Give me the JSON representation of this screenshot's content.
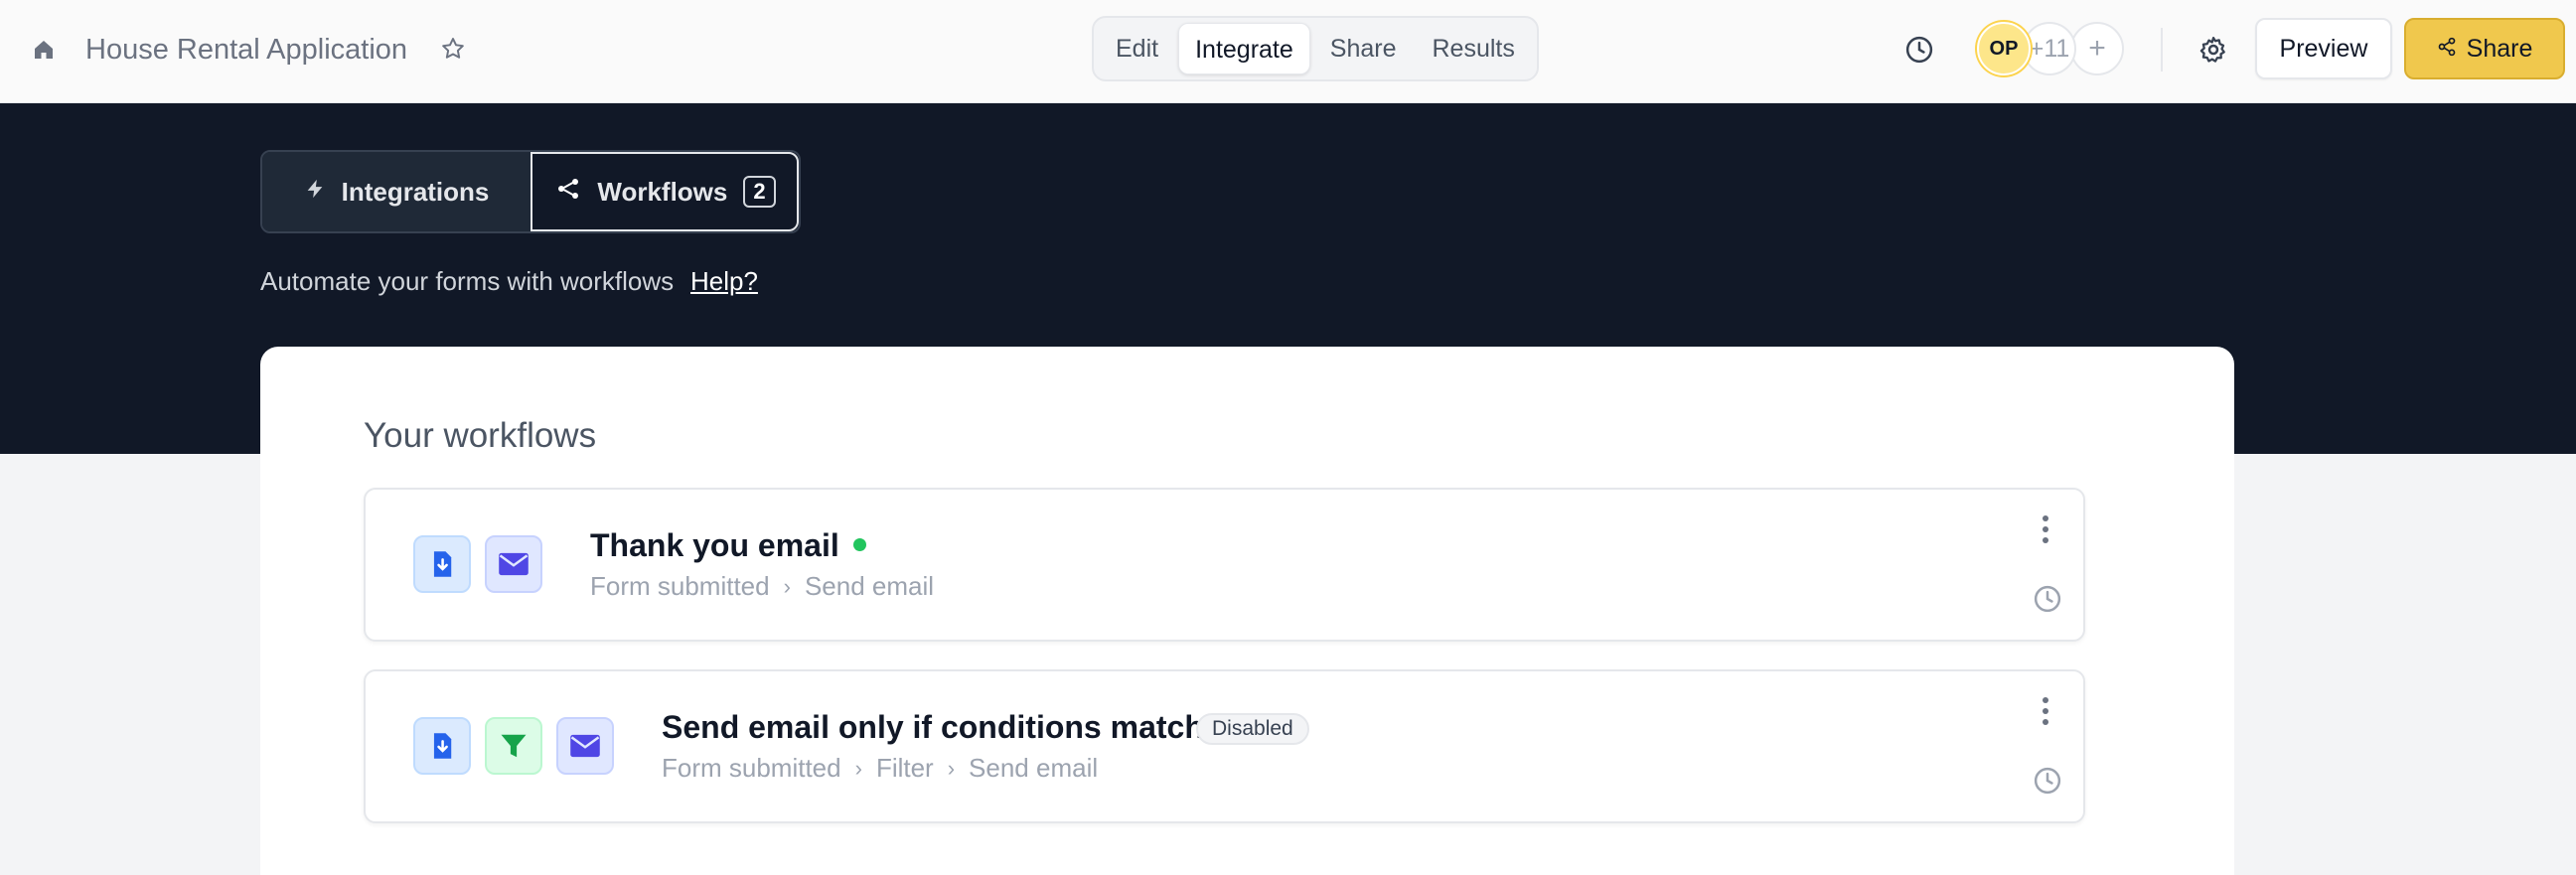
{
  "header": {
    "doc_title": "House Rental Application",
    "tabs": [
      {
        "label": "Edit"
      },
      {
        "label": "Integrate",
        "active": true
      },
      {
        "label": "Share"
      },
      {
        "label": "Results"
      }
    ],
    "avatar_initials": "OP",
    "more_collaborators": "+11",
    "add_collaborator": "+",
    "preview_label": "Preview",
    "share_label": "Share"
  },
  "hero": {
    "segments": {
      "integrations_label": "Integrations",
      "workflows_label": "Workflows",
      "workflows_count": "2"
    },
    "description": "Automate your forms with workflows",
    "help_label": "Help?"
  },
  "workflows_card": {
    "title": "Your workflows",
    "items": [
      {
        "name": "Thank you email",
        "status": "active",
        "steps": [
          "Form submitted",
          "Send email"
        ]
      },
      {
        "name": "Send email only if conditions match",
        "status": "disabled",
        "badge": "Disabled",
        "steps": [
          "Form submitted",
          "Filter",
          "Send email"
        ]
      }
    ]
  },
  "colors": {
    "hero_bg": "#111827",
    "share_button": "#f0c84d",
    "active_dot": "#22c55e",
    "form_icon": "#2563eb",
    "email_icon": "#4f46e5",
    "filter_icon": "#16a34a"
  },
  "icons": [
    "home-icon",
    "star-icon",
    "history-icon",
    "gear-icon",
    "share-nodes-icon",
    "bolt-icon",
    "workflow-icon",
    "form-download-icon",
    "envelope-icon",
    "filter-icon",
    "kebab-menu-icon",
    "clock-icon"
  ]
}
